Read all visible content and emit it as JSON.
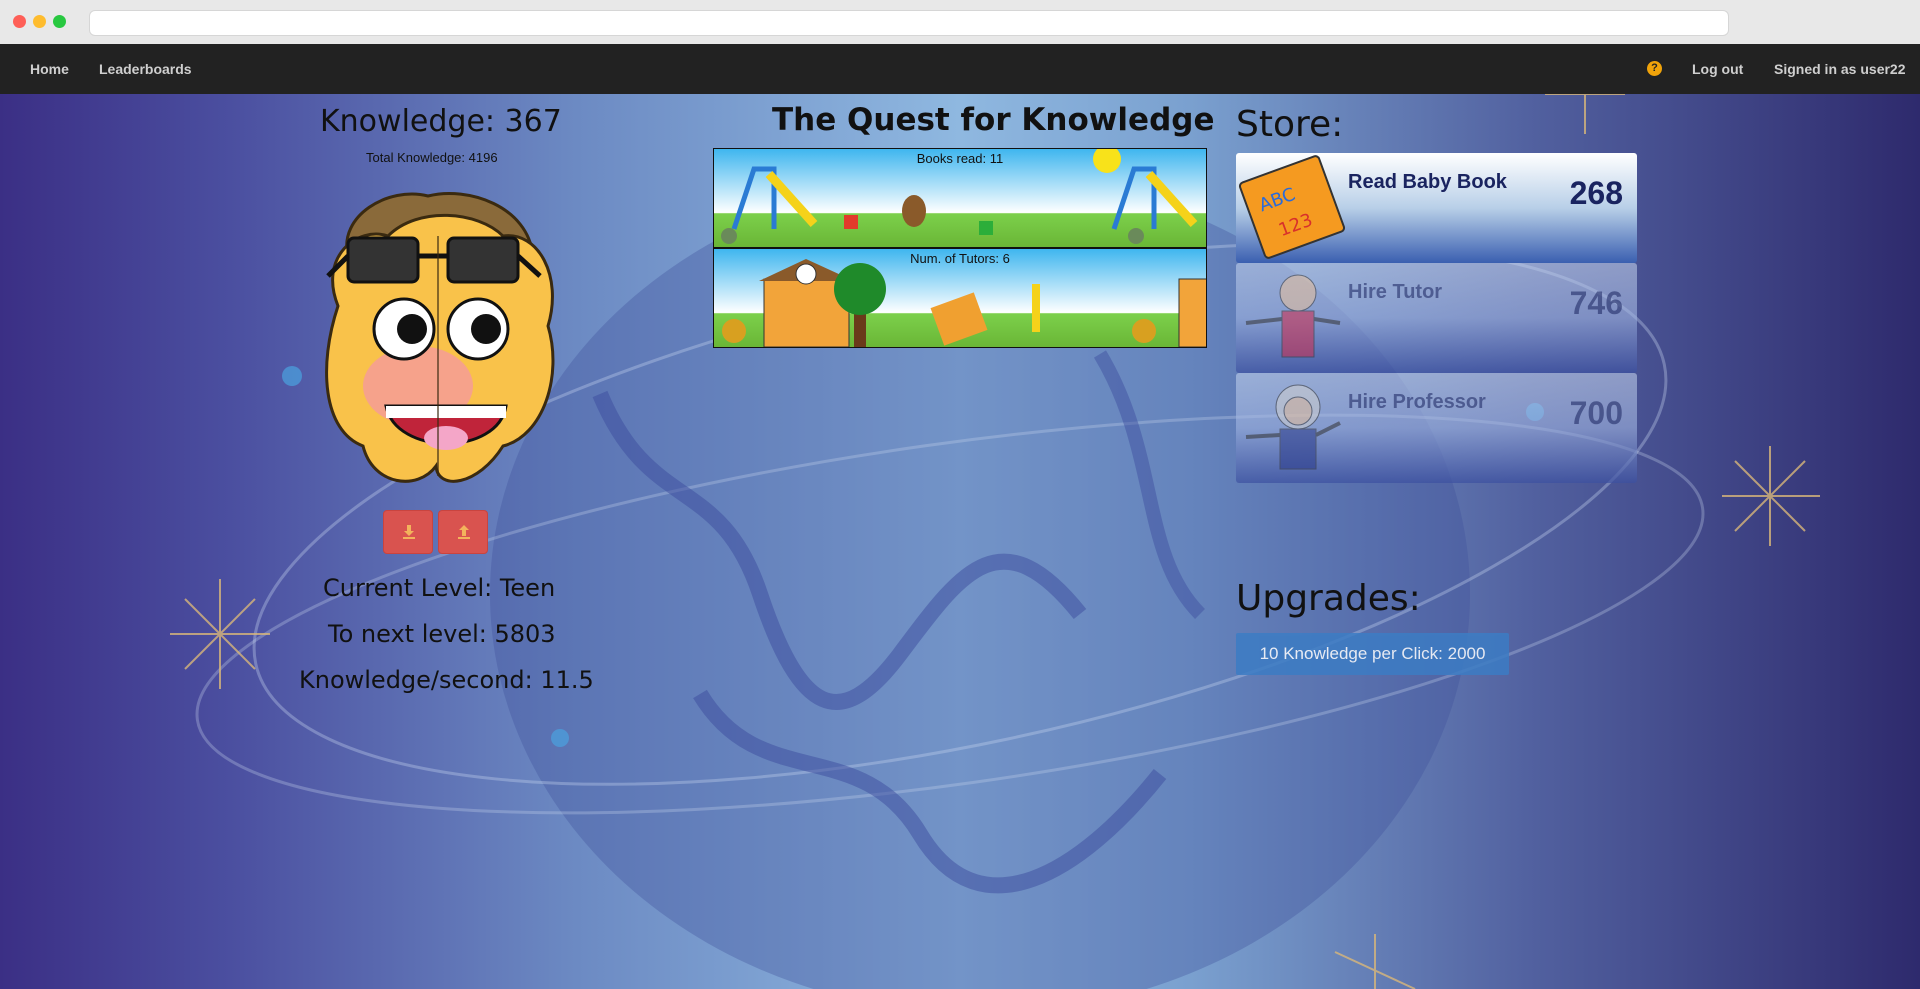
{
  "navbar": {
    "home": "Home",
    "leaderboards": "Leaderboards",
    "help": "?",
    "logout": "Log out",
    "signed_in": "Signed in as user22"
  },
  "left_panel": {
    "knowledge": "Knowledge: 367",
    "total_knowledge": "Total Knowledge: 4196",
    "current_level": "Current Level: Teen",
    "to_next_level": "To next level: 5803",
    "knowledge_per_second": "Knowledge/second: 11.5"
  },
  "center_panel": {
    "title": "The Quest for Knowledge",
    "strips": [
      {
        "caption": "Books read: 11"
      },
      {
        "caption": "Num. of Tutors: 6"
      }
    ]
  },
  "store": {
    "title": "Store:",
    "items": [
      {
        "name": "Read Baby Book",
        "cost": "268",
        "enabled": true
      },
      {
        "name": "Hire Tutor",
        "cost": "746",
        "enabled": false
      },
      {
        "name": "Hire Professor",
        "cost": "700",
        "enabled": false
      }
    ]
  },
  "upgrades": {
    "title": "Upgrades:",
    "items": [
      {
        "label": "10 Knowledge per Click: 2000"
      }
    ]
  },
  "icons": [
    "download-icon",
    "upload-icon",
    "help-icon"
  ],
  "colors": {
    "navbar": "#222222",
    "red_button": "#d9534f",
    "upgrade_button": "#3c7cc4",
    "help_icon": "#f0a30a"
  }
}
